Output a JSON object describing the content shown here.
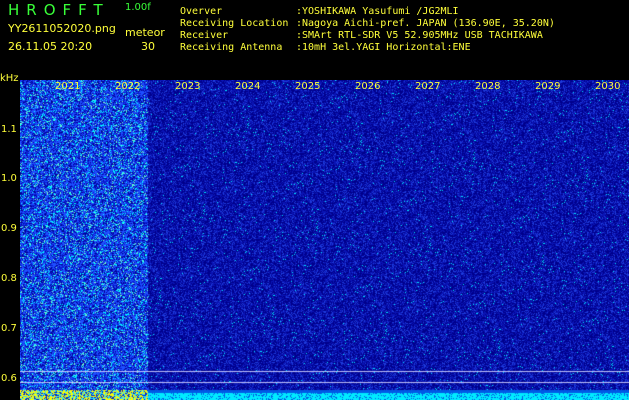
{
  "header": {
    "app_title": "HROFFT",
    "version": "1.00f",
    "filename": "YY2611052020.png",
    "meteor_label": "meteor",
    "timestamp": "26.11.05 20:20",
    "meteor_count": "30"
  },
  "info": [
    {
      "label": "Overver",
      "value": ":YOSHIKAWA Yasufumi /JG2MLI"
    },
    {
      "label": "Receiving Location",
      "value": ":Nagoya Aichi-pref. JAPAN (136.90E, 35.20N)"
    },
    {
      "label": "Receiver",
      "value": ":SMArt RTL-SDR V5 52.905MHz USB TACHIKAWA"
    },
    {
      "label": "Receiving Antenna",
      "value": ":10mH 3el.YAGI Horizontal:ENE"
    }
  ],
  "spectrogram": {
    "y_unit": "kHz",
    "y_ticks": [
      "1.1",
      "1.0",
      "0.9",
      "0.8",
      "0.7",
      "0.6"
    ],
    "x_ticks": [
      "2021",
      "2022",
      "2023",
      "2024",
      "2025",
      "2026",
      "2027",
      "2028",
      "2029",
      "2030"
    ],
    "bright_until_tick": "2022",
    "colors": {
      "background": "#00009a",
      "noise": "#2a50ff",
      "speck": "#00ffff",
      "strip": "#ffff00"
    }
  }
}
